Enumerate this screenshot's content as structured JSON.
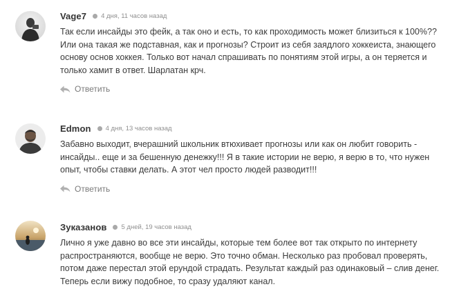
{
  "comments": [
    {
      "author": "Vage7",
      "date": "4 дня, 11 часов назад",
      "text": "Так если инсайды это фейк, а так оно и есть, то как проходимость может близиться к 100%?? Или она такая же подставная, как и прогнозы? Строит из себя заядлого хоккеиста, знающего основу основ хоккея. Только вот начал спрашивать по понятиям этой игры, а он теряется и только хамит в ответ. Шарлатан крч.",
      "reply_label": "Ответить",
      "avatar_icon": "user-photo-icon"
    },
    {
      "author": "Edmon",
      "date": "4 дня, 13 часов назад",
      "text": "Забавно выходит, вчерашний школьник втюхивает прогнозы или как он любит говорить - инсайды.. еще и за бешенную денежку!!! Я в такие истории не верю, я верю в то, что нужен опыт, чтобы ставки делать. А этот чел просто людей разводит!!!",
      "reply_label": "Ответить",
      "avatar_icon": "user-photo-icon"
    },
    {
      "author": "Зуказанов",
      "date": "5 дней, 19 часов назад",
      "text": "Лично я уже давно во все эти инсайды, которые тем более вот так открыто по интернету распространяются, вообще не верю. Это точно обман. Несколько раз пробовал проверять, потом даже перестал этой ерундой страдать. Результат каждый раз одинаковый – слив денег. Теперь если вижу подобное, то сразу удаляют канал.",
      "reply_label": "",
      "avatar_icon": "user-photo-icon"
    }
  ],
  "colors": {
    "text": "#3a3a3a",
    "author": "#333333",
    "meta": "#8f8f8f",
    "reply": "#7a7a7a",
    "reply_icon": "#b0b0b0"
  }
}
